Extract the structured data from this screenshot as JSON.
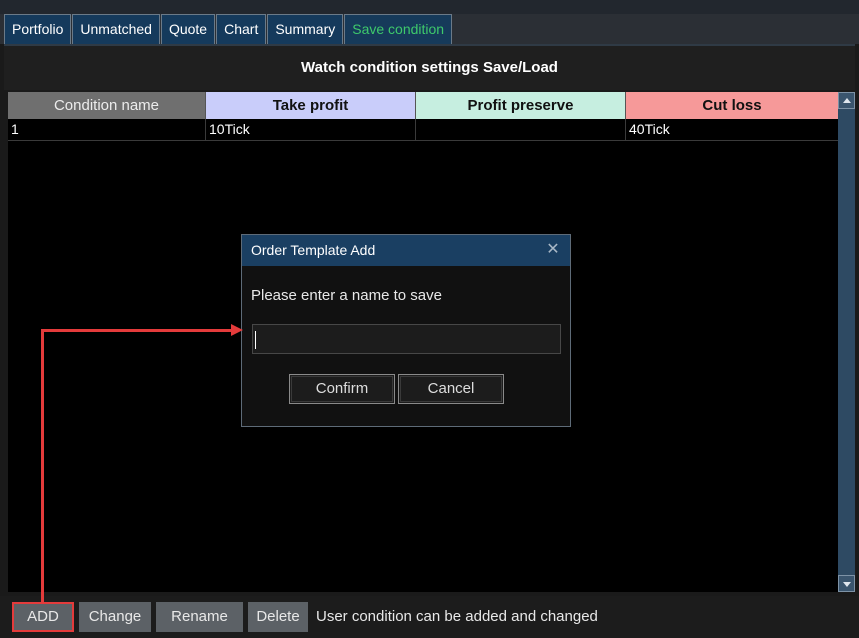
{
  "tabs": [
    {
      "label": "Portfolio",
      "active": false
    },
    {
      "label": "Unmatched",
      "active": false
    },
    {
      "label": "Quote",
      "active": false
    },
    {
      "label": "Chart",
      "active": false
    },
    {
      "label": "Summary",
      "active": false
    },
    {
      "label": "Save condition",
      "active": true
    }
  ],
  "panel": {
    "title": "Watch condition settings Save/Load"
  },
  "table": {
    "columns": [
      "Condition name",
      "Take profit",
      "Profit preserve",
      "Cut loss"
    ],
    "column_colors": [
      "#6f6f6f",
      "#c9cdfa",
      "#c6eee0",
      "#f69999"
    ],
    "rows": [
      [
        "1",
        "10Tick",
        "",
        "40Tick"
      ]
    ]
  },
  "scrollbar": {
    "up_icon": "arrow-up-icon",
    "down_icon": "arrow-down-icon"
  },
  "dialog": {
    "title": "Order Template Add",
    "close_icon": "close-icon",
    "message": "Please enter a name to save",
    "input_value": "",
    "confirm_label": "Confirm",
    "cancel_label": "Cancel"
  },
  "bottom": {
    "add_label": "ADD",
    "change_label": "Change",
    "rename_label": "Rename",
    "delete_label": "Delete",
    "status_text": "User condition can be added and changed"
  },
  "colors": {
    "accent_active_tab": "#3ec96b",
    "tab_bg": "#153a5c",
    "highlight": "#e43b3b"
  }
}
